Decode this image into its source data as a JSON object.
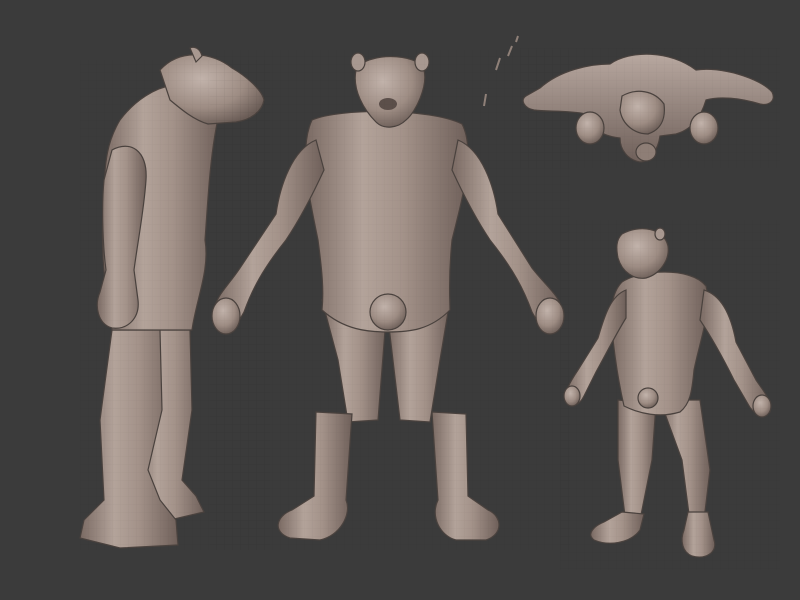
{
  "scene": {
    "background": "#3b3b3b",
    "clay": "#a5948b",
    "clay_shadow": "#6e5f58",
    "clay_highlight": "#c4b5ad",
    "views": [
      {
        "name": "side-view"
      },
      {
        "name": "front-view"
      },
      {
        "name": "top-view"
      },
      {
        "name": "three-quarter-view"
      }
    ]
  }
}
